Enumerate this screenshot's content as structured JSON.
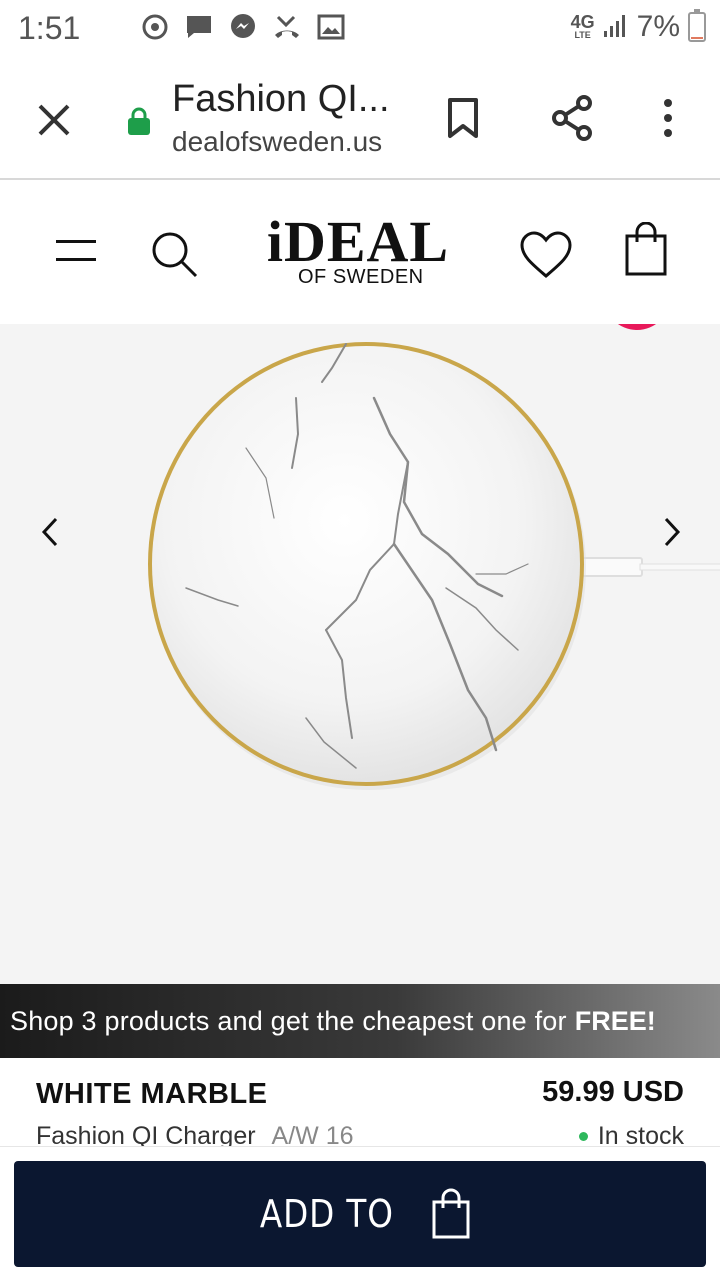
{
  "status_bar": {
    "time": "1:51",
    "network": "4G",
    "network_sub": "LTE",
    "battery_percent": "7%",
    "battery_level": 0.07,
    "icons": [
      "sync-icon",
      "chat-icon",
      "messenger-icon",
      "missed-call-icon",
      "image-icon",
      "signal-icon",
      "battery-icon"
    ]
  },
  "browser": {
    "title": "Fashion QI...",
    "url": "dealofsweden.us",
    "icons": [
      "close-icon",
      "lock-icon",
      "bookmark-icon",
      "share-icon",
      "more-vert-icon"
    ],
    "lock_color": "#1e9e4a"
  },
  "site_header": {
    "brand_main": "iDEAL",
    "brand_sub": "OF SWEDEN",
    "icons": [
      "hamburger-menu-icon",
      "search-icon",
      "heart-icon",
      "shopping-bag-icon"
    ]
  },
  "gallery": {
    "icons": [
      "chevron-left-icon",
      "chevron-right-icon"
    ],
    "badge_color": "#e8195a"
  },
  "promo": {
    "text": "Shop 3 products and get the cheapest one for",
    "highlight": "FREE!"
  },
  "product": {
    "name": "WHITE MARBLE",
    "subtitle": "Fashion QI Charger",
    "season": "A/W 16",
    "price": "59.99 USD",
    "stock": "In stock",
    "stock_color": "#2eb85c"
  },
  "cta": {
    "label": "ADD TO",
    "button_color": "#0b1730"
  }
}
